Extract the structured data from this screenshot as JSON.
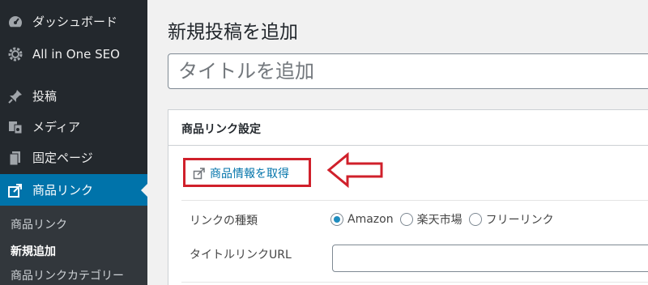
{
  "sidebar": {
    "items": [
      {
        "label": "ダッシュボード",
        "icon": "dashboard-icon"
      },
      {
        "label": "All in One SEO",
        "icon": "gear-icon"
      },
      {
        "label": "投稿",
        "icon": "pin-icon"
      },
      {
        "label": "メディア",
        "icon": "media-icon"
      },
      {
        "label": "固定ページ",
        "icon": "page-icon"
      },
      {
        "label": "商品リンク",
        "icon": "external-link-icon"
      }
    ],
    "submenu": [
      "商品リンク",
      "新規追加",
      "商品リンクカテゴリー"
    ]
  },
  "main": {
    "page_title": "新規投稿を追加",
    "title_placeholder": "タイトルを追加",
    "metabox": {
      "title": "商品リンク設定",
      "fetch_label": "商品情報を取得",
      "link_type_label": "リンクの種類",
      "radio_options": [
        "Amazon",
        "楽天市場",
        "フリーリンク"
      ],
      "selected_option": "Amazon",
      "title_url_label": "タイトルリンクURL"
    }
  },
  "colors": {
    "sidebar_bg": "#23282d",
    "active_bg": "#0073aa",
    "highlight_red": "#d0202b",
    "link_blue": "#0073aa"
  }
}
